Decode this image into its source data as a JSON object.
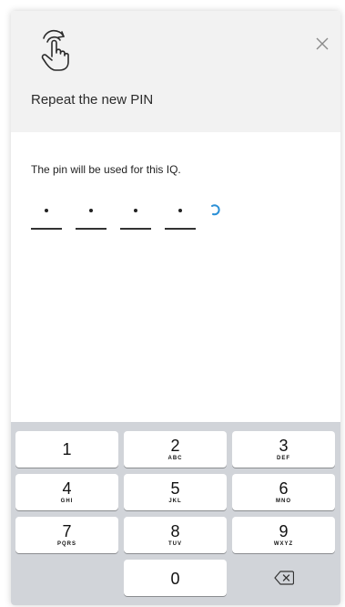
{
  "header": {
    "title": "Repeat the new PIN",
    "gesture_icon": "tap-gesture-icon",
    "close_icon": "close-icon"
  },
  "body": {
    "subtitle": "The pin will be used for this IQ.",
    "pin": {
      "length": 4,
      "entered": 4,
      "loading": true
    }
  },
  "keypad": {
    "keys": [
      {
        "num": "1",
        "letters": ""
      },
      {
        "num": "2",
        "letters": "ABC"
      },
      {
        "num": "3",
        "letters": "DEF"
      },
      {
        "num": "4",
        "letters": "GHI"
      },
      {
        "num": "5",
        "letters": "JKL"
      },
      {
        "num": "6",
        "letters": "MNO"
      },
      {
        "num": "7",
        "letters": "PQRS"
      },
      {
        "num": "8",
        "letters": "TUV"
      },
      {
        "num": "9",
        "letters": "WXYZ"
      },
      {
        "num": "0",
        "letters": ""
      }
    ],
    "delete_icon": "backspace-icon"
  },
  "colors": {
    "header_bg": "#f2f2f2",
    "keypad_bg": "#d1d4d9",
    "spinner": "#2a8fd6"
  }
}
